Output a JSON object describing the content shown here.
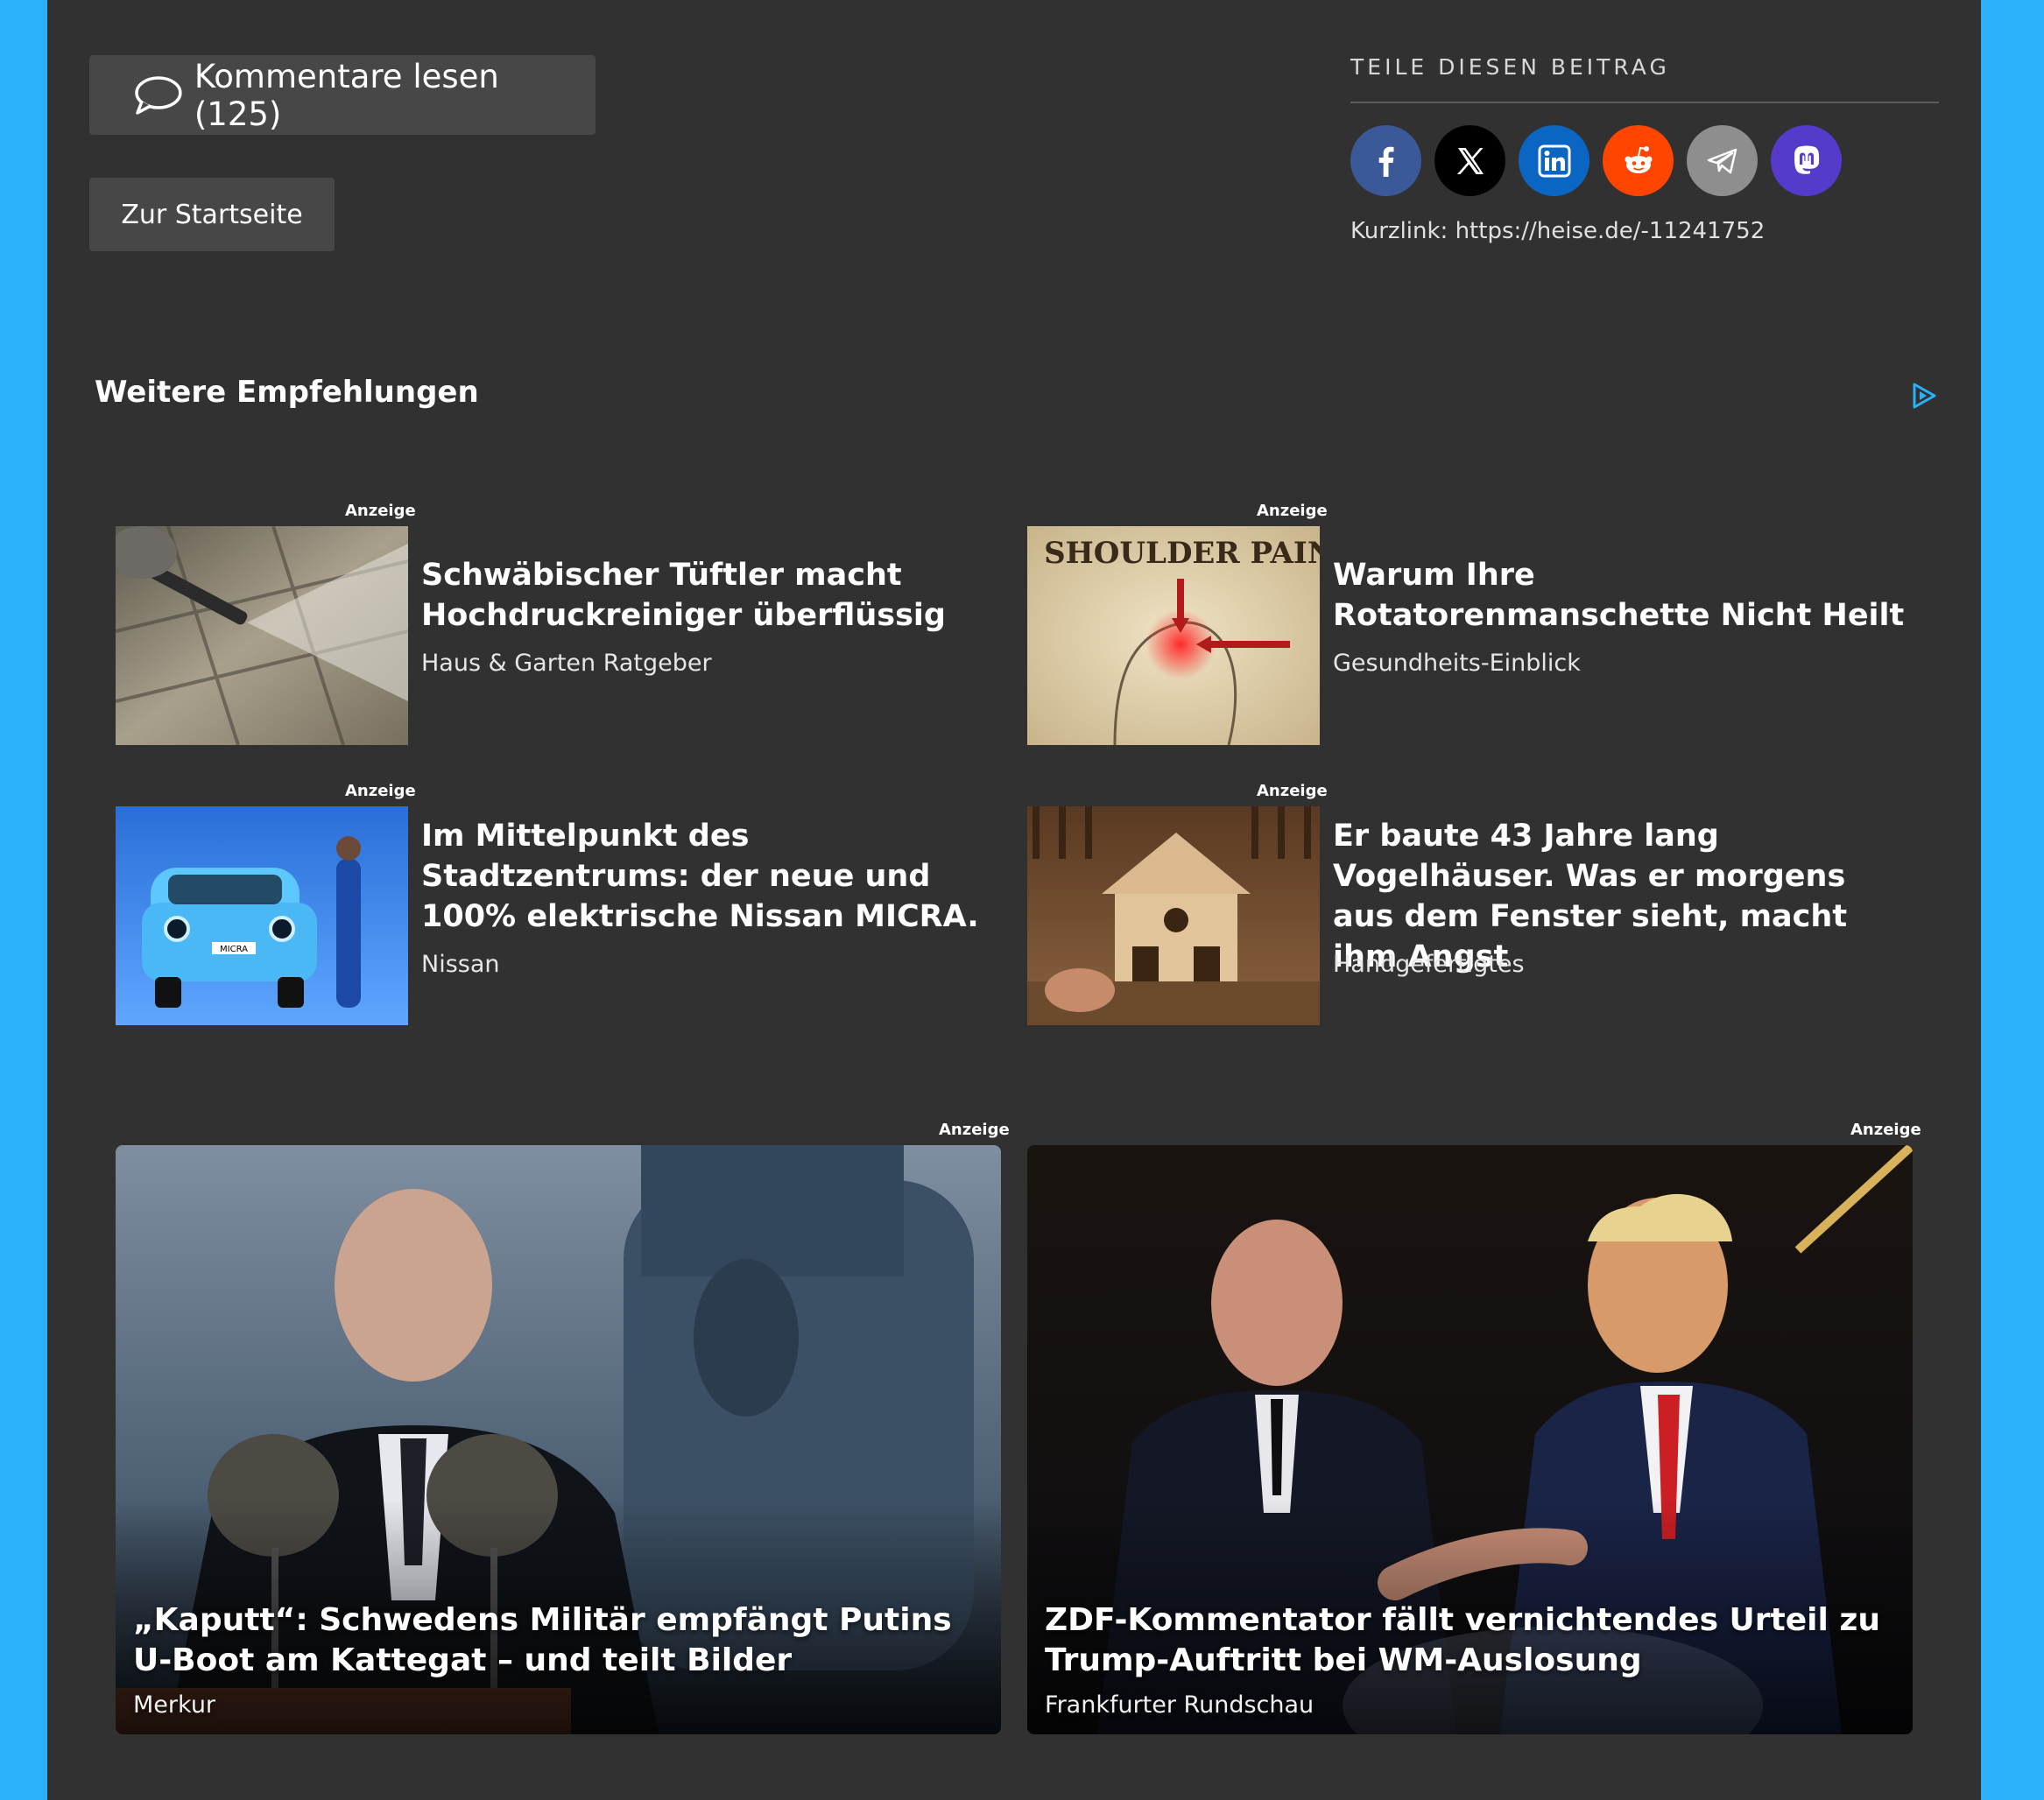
{
  "actions": {
    "comments_label": "Kommentare lesen (125)",
    "home_label": "Zur Startseite"
  },
  "share": {
    "title": "TEILE DIESEN BEITRAG",
    "icons": [
      {
        "name": "facebook-icon",
        "color": "#3b5998"
      },
      {
        "name": "x-icon",
        "color": "#000000"
      },
      {
        "name": "linkedin-icon",
        "color": "#0a66c2"
      },
      {
        "name": "reddit-icon",
        "color": "#ff4500"
      },
      {
        "name": "telegram-icon",
        "color": "#8e8e8e"
      },
      {
        "name": "mastodon-icon",
        "color": "#563acc"
      }
    ],
    "shortlink": "Kurzlink: https://heise.de/-11241752"
  },
  "recommendations": {
    "title": "Weitere Empfehlungen",
    "ad_label": "Anzeige",
    "cards": [
      {
        "title": "Schwäbischer Tüftler macht Hochdruckreiniger überflüssig",
        "source": "Haus & Garten Ratgeber"
      },
      {
        "title": "Warum Ihre Rotatorenmanschette Nicht Heilt",
        "source": "Gesundheits-Einblick",
        "image_text": "SHOULDER PAIN"
      },
      {
        "title": "Im Mittelpunkt des Stadtzentrums: der neue und 100% elektrische Nissan MICRA.",
        "source": "Nissan",
        "image_text": "MICRA"
      },
      {
        "title": "Er baute 43 Jahre lang Vogelhäuser. Was er morgens aus dem Fenster sieht, macht ihm Angst",
        "source": "Handgefertigtes"
      }
    ],
    "big_cards": [
      {
        "title": "„Kaputt“: Schwedens Militär empfängt Putins U-Boot am Kattegat – und teilt Bilder",
        "source": "Merkur"
      },
      {
        "title": "ZDF-Kommentator fällt vernichtendes Urteil zu Trump-Auftritt bei WM-Auslosung",
        "source": "Frankfurter Rundschau"
      }
    ]
  },
  "colors": {
    "page_background": "#313131",
    "side_background": "#2ab1f9",
    "button_background": "#474747"
  }
}
